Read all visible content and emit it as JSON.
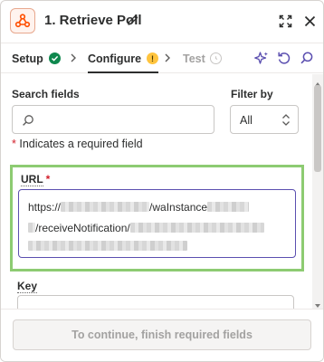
{
  "header": {
    "title": "1. Retrieve Poll",
    "icon": "webhook-icon",
    "accent": "#ff4f00"
  },
  "tabs": [
    {
      "label": "Setup",
      "status": "complete"
    },
    {
      "label": "Configure",
      "status": "warning",
      "badge": "!"
    },
    {
      "label": "Test",
      "status": "disabled"
    }
  ],
  "search": {
    "label": "Search fields",
    "placeholder": ""
  },
  "filter": {
    "label": "Filter by",
    "value": "All"
  },
  "required_note": {
    "star": "*",
    "text": "Indicates a required field"
  },
  "fields": {
    "url": {
      "label": "URL",
      "required_star": "*",
      "line1_start": "https://",
      "line1_mid": "/waInstance",
      "line2_start": "/receiveNotification/"
    },
    "key": {
      "label": "Key"
    }
  },
  "footer": {
    "continue_label": "To continue, finish required fields"
  },
  "colors": {
    "highlight": "#8dcb72",
    "focus": "#5b4fb0",
    "required": "#d21e2a",
    "ok": "#0f884e",
    "warn": "#ffc43e"
  }
}
